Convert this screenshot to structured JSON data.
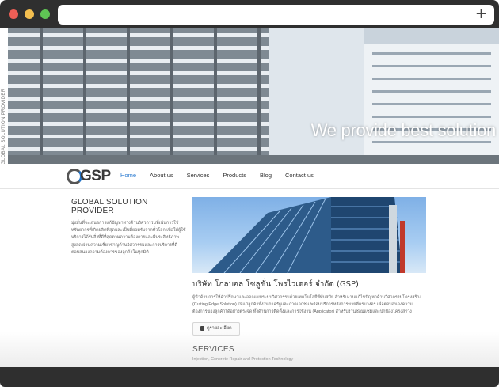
{
  "browser": {
    "new_tab_symbol": "+"
  },
  "side_text": "GLOBAL SOLUTION PROVIDER",
  "hero": {
    "tagline": "We provide best solution"
  },
  "logo": {
    "text": "GSP"
  },
  "nav": {
    "items": [
      {
        "label": "Home",
        "active": true
      },
      {
        "label": "About us",
        "active": false
      },
      {
        "label": "Services",
        "active": false
      },
      {
        "label": "Products",
        "active": false
      },
      {
        "label": "Blog",
        "active": false
      },
      {
        "label": "Contact us",
        "active": false
      }
    ]
  },
  "left": {
    "title": "GLOBAL SOLUTION PROVIDER",
    "body": "มุ่งมั่นที่จะเสนอการแก้ปัญหาทางด้านวิศวกรรมที่เน้นการใช้ทรัพยากรที่เกิดผลิตที่สุดและเป็นที่ยอมรับจากทั่วโลก เพื่อให้ผู้ใช้บริการได้รับสิ่งที่ดีที่สุดตามความต้องการและมีประสิทธิภาพสูงสุด ผ่านความเชี่ยวชาญด้านวิศวกรรมและการบริการที่ดี ตอบสนองความต้องการของลูกค้าในทุกมิติ"
  },
  "company": {
    "title": "บริษัท โกลบอล โซลูชั่น โพรไวเดอร์ จำกัด (GSP)",
    "body": "ผู้นำด้านการให้คำปรึกษาและออกแบบระบบวิศวกรรมด้วยเทคโนโลยีที่ทันสมัย สำหรับงานแก้ไขปัญหาด้านวิศวกรรมโครงสร้าง (Cutting Edge Solution) ให้แก่ลูกค้าทั้งในภาครัฐและภาคเอกชน พร้อมบริการหลังการขายที่ครบวงจร เพื่อตอบสนองความต้องการของลูกค้าได้อย่างตรงจุด ทั้งด้านการติดตั้งและการใช้งาน (Applicator) สำหรับงานซ่อมแซมและปกป้องโครงสร้าง",
    "more_label": "ดูรายละเอียด"
  },
  "services": {
    "title": "SERVICES",
    "subtitle": "Injection, Concrete Repair and Protection Technology"
  },
  "colors": {
    "chrome": "#2f2f2f",
    "nav_active": "#2a7ad0",
    "text_dark": "#333333"
  }
}
